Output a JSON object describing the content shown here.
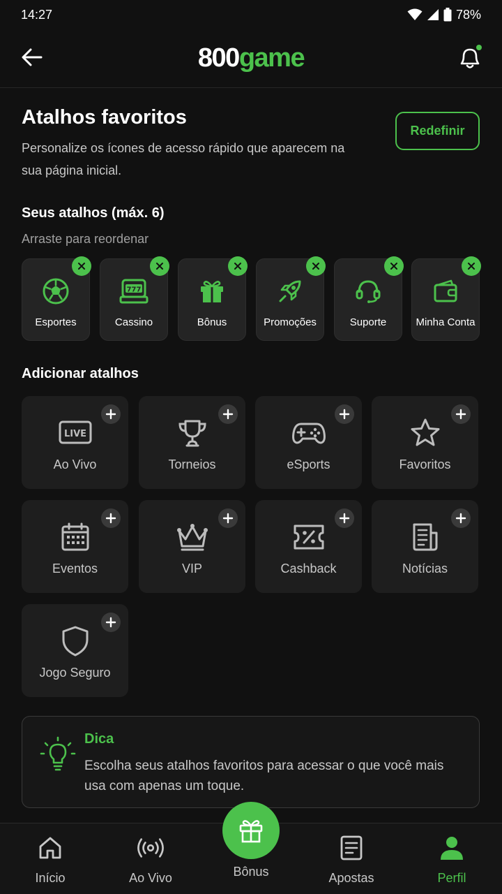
{
  "status": {
    "time": "14:27",
    "battery": "78%"
  },
  "header": {
    "logo_num": "800",
    "logo_word": "game"
  },
  "page": {
    "title": "Atalhos favoritos",
    "description": "Personalize os ícones de acesso rápido que aparecem na sua página inicial.",
    "reset_label": "Redefinir"
  },
  "favorites": {
    "title": "Seus atalhos (máx. 6)",
    "subtitle": "Arraste para reordenar",
    "items": [
      {
        "label": "Esportes",
        "icon": "soccer-ball-icon"
      },
      {
        "label": "Cassino",
        "icon": "slot-machine-icon"
      },
      {
        "label": "Bônus",
        "icon": "gift-icon"
      },
      {
        "label": "Promoções",
        "icon": "rocket-icon"
      },
      {
        "label": "Suporte",
        "icon": "headset-icon"
      },
      {
        "label": "Minha Conta",
        "icon": "wallet-icon"
      }
    ]
  },
  "add_section": {
    "title": "Adicionar atalhos",
    "live_badge": "LIVE",
    "items": [
      {
        "label": "Ao Vivo",
        "icon": "live-tv-icon"
      },
      {
        "label": "Torneios",
        "icon": "trophy-icon"
      },
      {
        "label": "eSports",
        "icon": "gamepad-icon"
      },
      {
        "label": "Favoritos",
        "icon": "star-icon"
      },
      {
        "label": "Eventos",
        "icon": "calendar-icon"
      },
      {
        "label": "VIP",
        "icon": "crown-icon"
      },
      {
        "label": "Cashback",
        "icon": "ticket-percent-icon"
      },
      {
        "label": "Notícias",
        "icon": "newspaper-icon"
      },
      {
        "label": "Jogo Seguro",
        "icon": "shield-icon"
      }
    ]
  },
  "tip": {
    "title": "Dica",
    "text": "Escolha seus atalhos favoritos para acessar o que você mais usa com apenas um toque."
  },
  "nav": {
    "items": [
      {
        "label": "Início",
        "icon": "home-icon"
      },
      {
        "label": "Ao Vivo",
        "icon": "broadcast-icon"
      },
      {
        "label": "Bônus",
        "icon": "gift-icon"
      },
      {
        "label": "Apostas",
        "icon": "bet-slip-icon"
      },
      {
        "label": "Perfil",
        "icon": "user-icon"
      }
    ],
    "active": "Perfil"
  },
  "colors": {
    "accent": "#4cc14c",
    "background": "#111111",
    "tile": "#242424",
    "add_tile": "#1e1e1e"
  }
}
